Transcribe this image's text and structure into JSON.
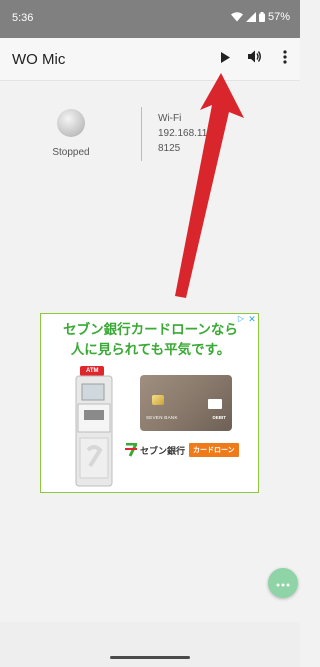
{
  "status_bar": {
    "time": "5:36",
    "battery_percent": "57%",
    "icons": [
      "wifi-icon",
      "signal-icon",
      "battery-icon"
    ]
  },
  "app_bar": {
    "title": "WO Mic",
    "actions": [
      "play-icon",
      "volume-icon",
      "more-vert-icon"
    ]
  },
  "connection": {
    "status": "Stopped",
    "transport": "Wi-Fi",
    "ip_address": "192.168.11.5",
    "port": "8125"
  },
  "ad": {
    "headline_line1": "セブン銀行カードローンなら",
    "headline_line2": "人に見られても平気です。",
    "atm_label": "ATM",
    "card_bank": "SEVEN BANK",
    "card_type": "DEBIT",
    "bank_name": "セブン銀行",
    "bank_tag": "カードローン",
    "info_icon": "▷",
    "close_icon": "✕"
  },
  "colors": {
    "status_bar": "#808080",
    "arrow": "#d9262c",
    "ad_green": "#3aa935",
    "fab": "#8fd4a6"
  }
}
